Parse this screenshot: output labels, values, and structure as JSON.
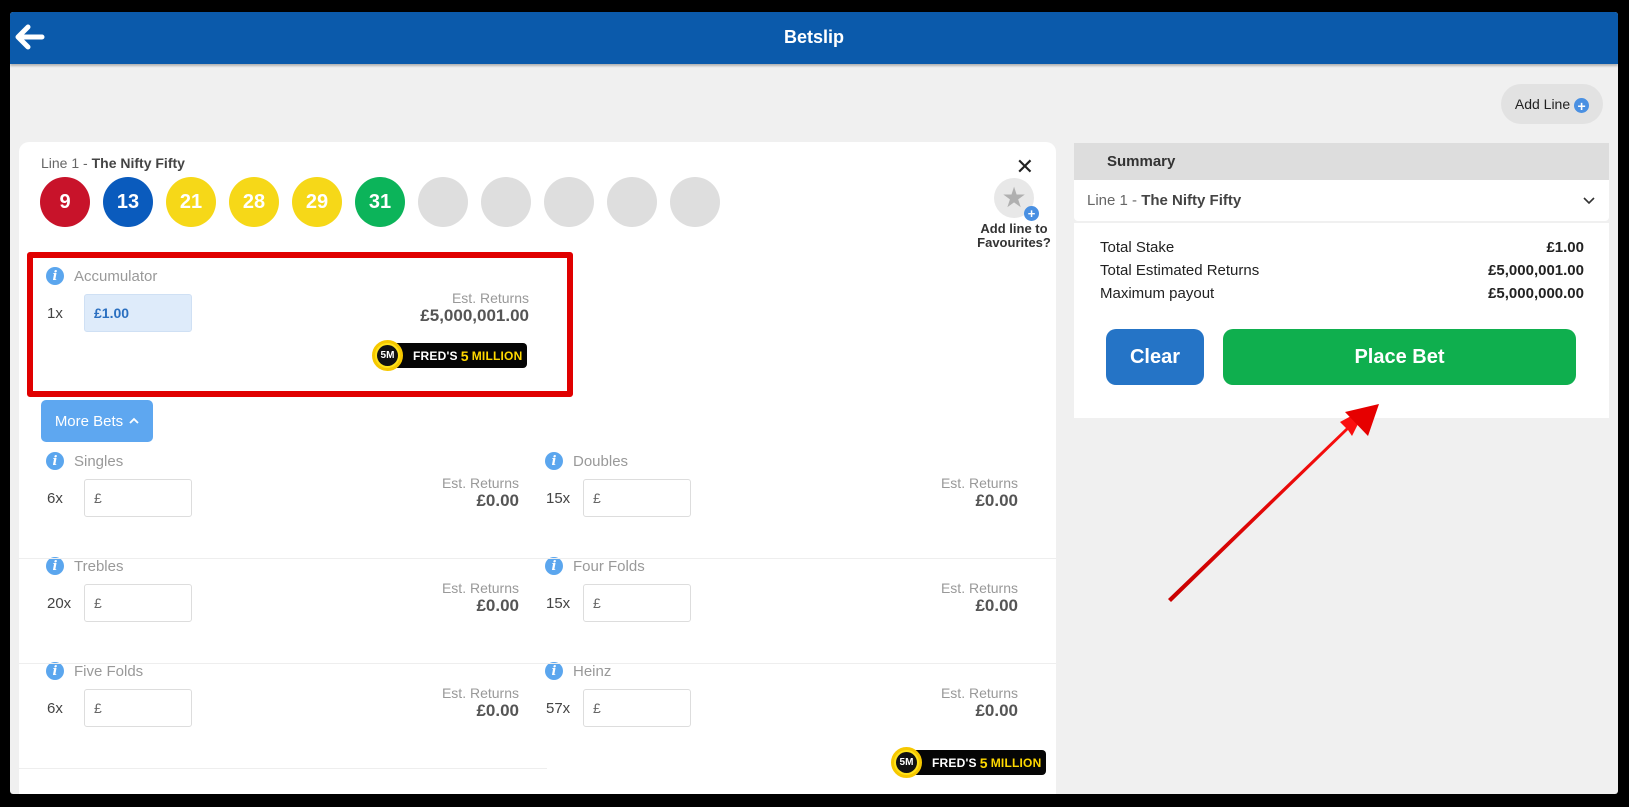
{
  "header": {
    "title": "Betslip",
    "back_icon": "arrow-left-icon"
  },
  "add_line": {
    "label": "Add Line",
    "icon": "plus-circle-icon"
  },
  "line": {
    "prefix": "Line 1 - ",
    "name": "The Nifty Fifty",
    "balls": [
      {
        "number": "9",
        "color": "#c8132a"
      },
      {
        "number": "13",
        "color": "#0a5bbd"
      },
      {
        "number": "21",
        "color": "#f6d818"
      },
      {
        "number": "28",
        "color": "#f6d818"
      },
      {
        "number": "29",
        "color": "#f6d818"
      },
      {
        "number": "31",
        "color": "#0cb45a"
      },
      {
        "number": "",
        "color": "#dedede"
      },
      {
        "number": "",
        "color": "#dedede"
      },
      {
        "number": "",
        "color": "#dedede"
      },
      {
        "number": "",
        "color": "#dedede"
      },
      {
        "number": "",
        "color": "#dedede"
      }
    ],
    "favourite_line1": "Add line to",
    "favourite_line2": "Favourites?"
  },
  "accumulator": {
    "label": "Accumulator",
    "multiplier": "1x",
    "stake": "£1.00",
    "est_label": "Est. Returns",
    "est_value": "£5,000,001.00",
    "badge": {
      "prefix": "FRED'S",
      "highlight": "5",
      "suffix": "MILLION",
      "coin": "5M"
    }
  },
  "more_bets": {
    "label": "More Bets",
    "icon": "chevron-up-icon"
  },
  "bets": [
    {
      "label": "Singles",
      "multiplier": "6x",
      "placeholder": "£",
      "est_label": "Est. Returns",
      "est_value": "£0.00"
    },
    {
      "label": "Doubles",
      "multiplier": "15x",
      "placeholder": "£",
      "est_label": "Est. Returns",
      "est_value": "£0.00"
    },
    {
      "label": "Trebles",
      "multiplier": "20x",
      "placeholder": "£",
      "est_label": "Est. Returns",
      "est_value": "£0.00"
    },
    {
      "label": "Four Folds",
      "multiplier": "15x",
      "placeholder": "£",
      "est_label": "Est. Returns",
      "est_value": "£0.00"
    },
    {
      "label": "Five Folds",
      "multiplier": "6x",
      "placeholder": "£",
      "est_label": "Est. Returns",
      "est_value": "£0.00"
    },
    {
      "label": "Heinz",
      "multiplier": "57x",
      "placeholder": "£",
      "est_label": "Est. Returns",
      "est_value": "£0.00"
    }
  ],
  "heinz_badge": {
    "prefix": "FRED'S",
    "highlight": "5",
    "suffix": "MILLION",
    "coin": "5M"
  },
  "summary": {
    "title": "Summary",
    "line_prefix": "Line 1 - ",
    "line_name": "The Nifty Fifty",
    "rows": [
      {
        "label": "Total Stake",
        "value": "£1.00"
      },
      {
        "label": "Total Estimated Returns",
        "value": "£5,000,001.00"
      },
      {
        "label": "Maximum payout",
        "value": "£5,000,000.00"
      }
    ],
    "clear_label": "Clear",
    "place_label": "Place Bet"
  },
  "annotation_color": "#e00000"
}
